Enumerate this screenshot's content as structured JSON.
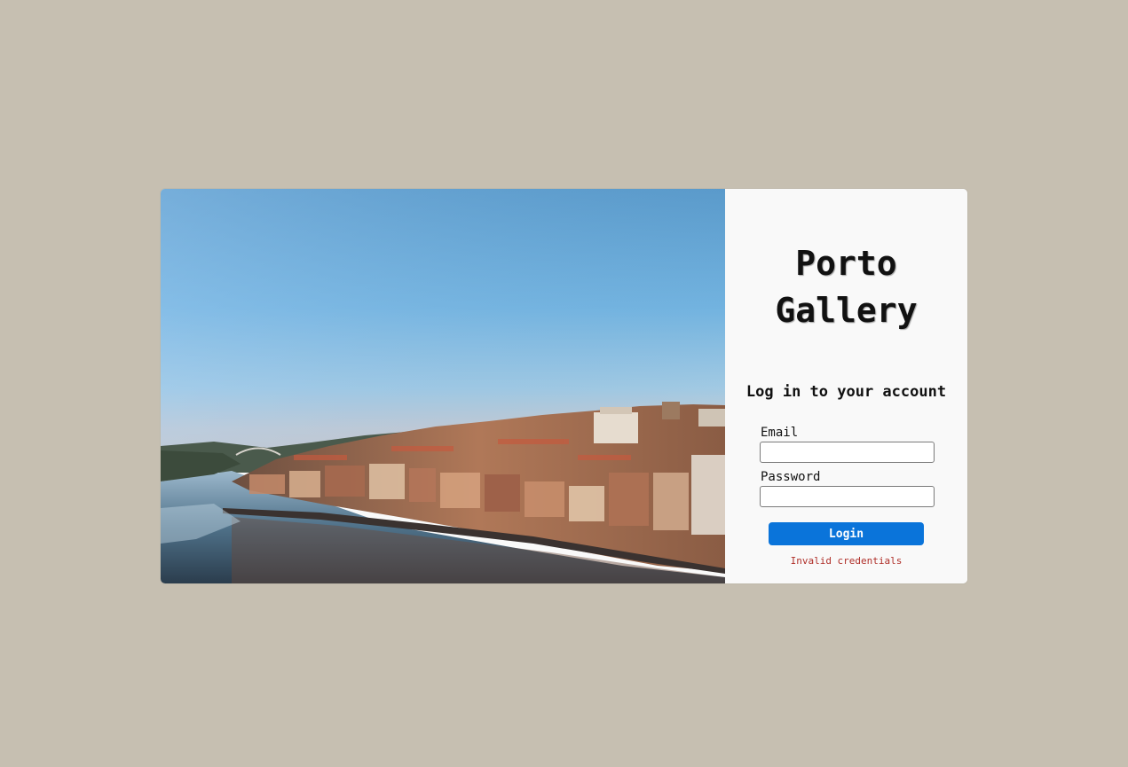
{
  "brand": {
    "line1": "Porto",
    "line2": "Gallery"
  },
  "login": {
    "heading": "Log in to your account",
    "email_label": "Email",
    "email_value": "",
    "password_label": "Password",
    "password_value": "",
    "submit_label": "Login",
    "error_message": "Invalid credentials"
  },
  "theme": {
    "page_background": "#c6bfb1",
    "panel_background": "#f9f9f9",
    "accent": "#0a74da",
    "error": "#b0302a"
  },
  "hero_image": {
    "subject": "porto-riverside-cityscape"
  }
}
